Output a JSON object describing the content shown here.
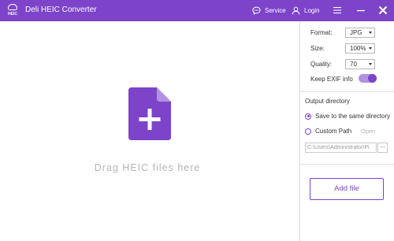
{
  "app": {
    "title": "Deli HEIC Converter",
    "icon_text": "HEIC"
  },
  "header": {
    "service_label": "Service",
    "login_label": "Login"
  },
  "drop_area": {
    "hint": "Drag HEIC files here"
  },
  "settings": {
    "format": {
      "label": "Format:",
      "value": "JPG"
    },
    "size": {
      "label": "Size:",
      "value": "100%"
    },
    "quality": {
      "label": "Quality:",
      "value": "70"
    },
    "keep_exif": {
      "label": "Keep EXIF info",
      "enabled": true
    }
  },
  "output": {
    "title": "Output directory",
    "same_directory_label": "Save to the same directory",
    "same_directory_selected": true,
    "custom_path_label": "Custom Path",
    "open_label": "Open",
    "path_value": "C:\\Users\\Administrator\\Pi",
    "browse_label": "..."
  },
  "actions": {
    "add_file_label": "Add file"
  },
  "colors": {
    "accent": "#7d44c9",
    "toggle_track": "#b292e0",
    "hint_text": "#b4b4b4"
  },
  "icons": [
    "heic-cloud-icon",
    "chat-bubble-icon",
    "user-icon",
    "hamburger-menu-icon",
    "minimize-icon",
    "close-icon",
    "add-file-icon"
  ]
}
